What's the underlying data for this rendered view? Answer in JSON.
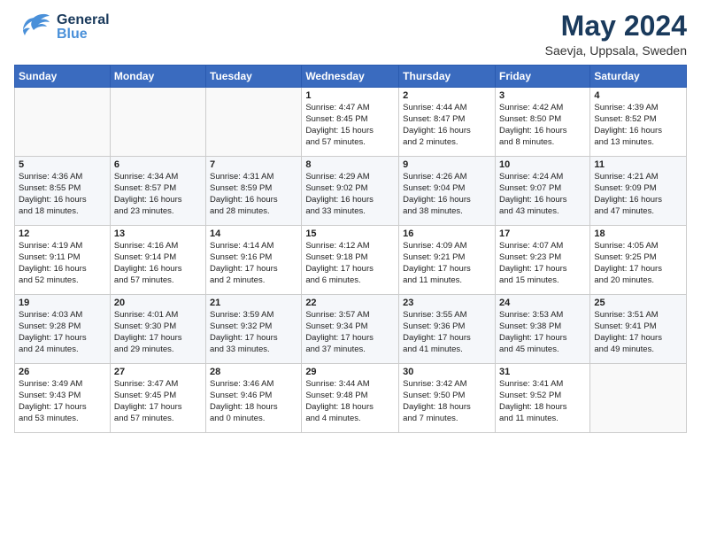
{
  "header": {
    "logo": {
      "general": "General",
      "blue": "Blue"
    },
    "title": "May 2024",
    "location": "Saevja, Uppsala, Sweden"
  },
  "weekdays": [
    "Sunday",
    "Monday",
    "Tuesday",
    "Wednesday",
    "Thursday",
    "Friday",
    "Saturday"
  ],
  "weeks": [
    [
      {
        "day": "",
        "info": ""
      },
      {
        "day": "",
        "info": ""
      },
      {
        "day": "",
        "info": ""
      },
      {
        "day": "1",
        "info": "Sunrise: 4:47 AM\nSunset: 8:45 PM\nDaylight: 15 hours\nand 57 minutes."
      },
      {
        "day": "2",
        "info": "Sunrise: 4:44 AM\nSunset: 8:47 PM\nDaylight: 16 hours\nand 2 minutes."
      },
      {
        "day": "3",
        "info": "Sunrise: 4:42 AM\nSunset: 8:50 PM\nDaylight: 16 hours\nand 8 minutes."
      },
      {
        "day": "4",
        "info": "Sunrise: 4:39 AM\nSunset: 8:52 PM\nDaylight: 16 hours\nand 13 minutes."
      }
    ],
    [
      {
        "day": "5",
        "info": "Sunrise: 4:36 AM\nSunset: 8:55 PM\nDaylight: 16 hours\nand 18 minutes."
      },
      {
        "day": "6",
        "info": "Sunrise: 4:34 AM\nSunset: 8:57 PM\nDaylight: 16 hours\nand 23 minutes."
      },
      {
        "day": "7",
        "info": "Sunrise: 4:31 AM\nSunset: 8:59 PM\nDaylight: 16 hours\nand 28 minutes."
      },
      {
        "day": "8",
        "info": "Sunrise: 4:29 AM\nSunset: 9:02 PM\nDaylight: 16 hours\nand 33 minutes."
      },
      {
        "day": "9",
        "info": "Sunrise: 4:26 AM\nSunset: 9:04 PM\nDaylight: 16 hours\nand 38 minutes."
      },
      {
        "day": "10",
        "info": "Sunrise: 4:24 AM\nSunset: 9:07 PM\nDaylight: 16 hours\nand 43 minutes."
      },
      {
        "day": "11",
        "info": "Sunrise: 4:21 AM\nSunset: 9:09 PM\nDaylight: 16 hours\nand 47 minutes."
      }
    ],
    [
      {
        "day": "12",
        "info": "Sunrise: 4:19 AM\nSunset: 9:11 PM\nDaylight: 16 hours\nand 52 minutes."
      },
      {
        "day": "13",
        "info": "Sunrise: 4:16 AM\nSunset: 9:14 PM\nDaylight: 16 hours\nand 57 minutes."
      },
      {
        "day": "14",
        "info": "Sunrise: 4:14 AM\nSunset: 9:16 PM\nDaylight: 17 hours\nand 2 minutes."
      },
      {
        "day": "15",
        "info": "Sunrise: 4:12 AM\nSunset: 9:18 PM\nDaylight: 17 hours\nand 6 minutes."
      },
      {
        "day": "16",
        "info": "Sunrise: 4:09 AM\nSunset: 9:21 PM\nDaylight: 17 hours\nand 11 minutes."
      },
      {
        "day": "17",
        "info": "Sunrise: 4:07 AM\nSunset: 9:23 PM\nDaylight: 17 hours\nand 15 minutes."
      },
      {
        "day": "18",
        "info": "Sunrise: 4:05 AM\nSunset: 9:25 PM\nDaylight: 17 hours\nand 20 minutes."
      }
    ],
    [
      {
        "day": "19",
        "info": "Sunrise: 4:03 AM\nSunset: 9:28 PM\nDaylight: 17 hours\nand 24 minutes."
      },
      {
        "day": "20",
        "info": "Sunrise: 4:01 AM\nSunset: 9:30 PM\nDaylight: 17 hours\nand 29 minutes."
      },
      {
        "day": "21",
        "info": "Sunrise: 3:59 AM\nSunset: 9:32 PM\nDaylight: 17 hours\nand 33 minutes."
      },
      {
        "day": "22",
        "info": "Sunrise: 3:57 AM\nSunset: 9:34 PM\nDaylight: 17 hours\nand 37 minutes."
      },
      {
        "day": "23",
        "info": "Sunrise: 3:55 AM\nSunset: 9:36 PM\nDaylight: 17 hours\nand 41 minutes."
      },
      {
        "day": "24",
        "info": "Sunrise: 3:53 AM\nSunset: 9:38 PM\nDaylight: 17 hours\nand 45 minutes."
      },
      {
        "day": "25",
        "info": "Sunrise: 3:51 AM\nSunset: 9:41 PM\nDaylight: 17 hours\nand 49 minutes."
      }
    ],
    [
      {
        "day": "26",
        "info": "Sunrise: 3:49 AM\nSunset: 9:43 PM\nDaylight: 17 hours\nand 53 minutes."
      },
      {
        "day": "27",
        "info": "Sunrise: 3:47 AM\nSunset: 9:45 PM\nDaylight: 17 hours\nand 57 minutes."
      },
      {
        "day": "28",
        "info": "Sunrise: 3:46 AM\nSunset: 9:46 PM\nDaylight: 18 hours\nand 0 minutes."
      },
      {
        "day": "29",
        "info": "Sunrise: 3:44 AM\nSunset: 9:48 PM\nDaylight: 18 hours\nand 4 minutes."
      },
      {
        "day": "30",
        "info": "Sunrise: 3:42 AM\nSunset: 9:50 PM\nDaylight: 18 hours\nand 7 minutes."
      },
      {
        "day": "31",
        "info": "Sunrise: 3:41 AM\nSunset: 9:52 PM\nDaylight: 18 hours\nand 11 minutes."
      },
      {
        "day": "",
        "info": ""
      }
    ]
  ]
}
